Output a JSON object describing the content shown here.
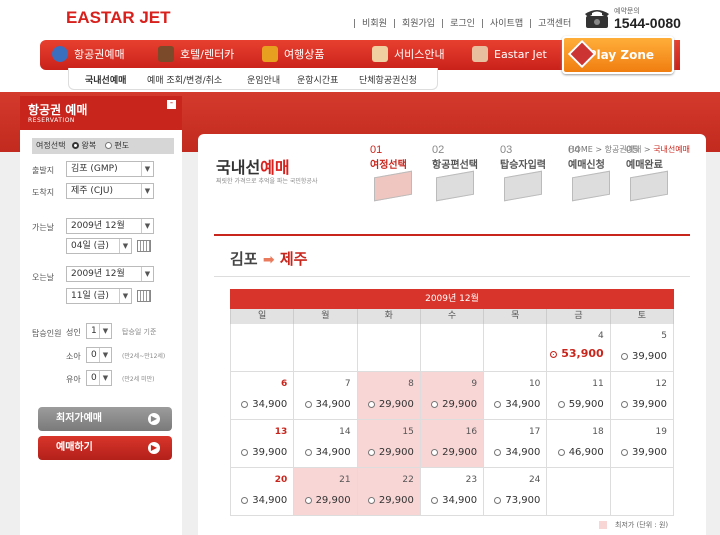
{
  "header": {
    "logo": "EASTAR JET",
    "top_links": [
      "비회원",
      "회원가입",
      "로그인",
      "사이트맵",
      "고객센터"
    ],
    "phone_label": "예약문의",
    "phone_number": "1544-0080"
  },
  "main_nav": [
    {
      "label": "항공권예매",
      "color": "#3a6fc0"
    },
    {
      "label": "호텔/렌터카",
      "color": "#7a4a2a"
    },
    {
      "label": "여행상품",
      "color": "#e8a020"
    },
    {
      "label": "서비스안내",
      "color": "#f0d0a0"
    },
    {
      "label": "Eastar Jet",
      "color": "#e8c0a0"
    }
  ],
  "play_zone": "Play Zone",
  "sub_nav": [
    "국내선예매",
    "예매 조회/변경/취소",
    "운임안내",
    "운항시간표",
    "단체항공권신청"
  ],
  "left_panel": {
    "title": "항공권 예매",
    "subtitle": "RESERVATION",
    "trip_label": "여정선택",
    "round_trip": "왕복",
    "one_way": "편도",
    "from_label": "출발지",
    "from_value": "김포 (GMP)",
    "to_label": "도착지",
    "to_value": "제주 (CJU)",
    "depart_label": "가는날",
    "depart_month": "2009년 12월",
    "depart_day": "04일 (금)",
    "return_label": "오는날",
    "return_month": "2009년 12월",
    "return_day": "11일 (금)",
    "pax_label": "탑승인원",
    "adult_label": "성인",
    "adult_value": "1",
    "adult_note": "탑승일 기준",
    "child_label": "소아",
    "child_value": "0",
    "child_note": "(만2세~만12세)",
    "infant_label": "유아",
    "infant_value": "0",
    "infant_note": "(만2세 미만)",
    "btn_lowest": "최저가예매",
    "btn_book": "예매하기"
  },
  "main": {
    "breadcrumb": [
      "HOME",
      "항공권예매",
      "국내선예매"
    ],
    "title_a": "국내선",
    "title_b": "예매",
    "desc": "찌릿한 가격으로 추억을 파는 국민항공사",
    "steps": [
      {
        "n": "01",
        "a": "여정",
        "b": "선택",
        "active": true
      },
      {
        "n": "02",
        "a": "항공편",
        "b": "선택",
        "active": false
      },
      {
        "n": "03",
        "a": "탑승자",
        "b": "입력",
        "active": false
      },
      {
        "n": "04",
        "a": "예매",
        "b": "신청",
        "active": false
      },
      {
        "n": "05",
        "a": "예매",
        "b": "완료",
        "active": false
      }
    ],
    "route_from": "김포",
    "route_to": "제주",
    "route_arrow": "➡"
  },
  "calendar": {
    "title": "2009년 12월",
    "weekdays": [
      "일",
      "월",
      "화",
      "수",
      "목",
      "금",
      "토"
    ],
    "weeks": [
      [
        null,
        null,
        null,
        null,
        null,
        {
          "d": "4",
          "p": "53,900",
          "sel": true
        },
        {
          "d": "5",
          "p": "39,900"
        }
      ],
      [
        {
          "d": "6",
          "p": "34,900",
          "red": true
        },
        {
          "d": "7",
          "p": "34,900"
        },
        {
          "d": "8",
          "p": "29,900",
          "low": true
        },
        {
          "d": "9",
          "p": "29,900",
          "low": true
        },
        {
          "d": "10",
          "p": "34,900"
        },
        {
          "d": "11",
          "p": "59,900"
        },
        {
          "d": "12",
          "p": "39,900"
        }
      ],
      [
        {
          "d": "13",
          "p": "39,900",
          "red": true
        },
        {
          "d": "14",
          "p": "34,900"
        },
        {
          "d": "15",
          "p": "29,900",
          "low": true
        },
        {
          "d": "16",
          "p": "29,900",
          "low": true
        },
        {
          "d": "17",
          "p": "34,900"
        },
        {
          "d": "18",
          "p": "46,900"
        },
        {
          "d": "19",
          "p": "39,900"
        }
      ],
      [
        {
          "d": "20",
          "p": "34,900",
          "red": true
        },
        {
          "d": "21",
          "p": "29,900",
          "low": true
        },
        {
          "d": "22",
          "p": "29,900",
          "low": true
        },
        {
          "d": "23",
          "p": "34,900"
        },
        {
          "d": "24",
          "p": "73,900"
        },
        null,
        null
      ]
    ],
    "legend": "최저가 (단위 : 원)",
    "low_color": "#f9d6d6"
  }
}
